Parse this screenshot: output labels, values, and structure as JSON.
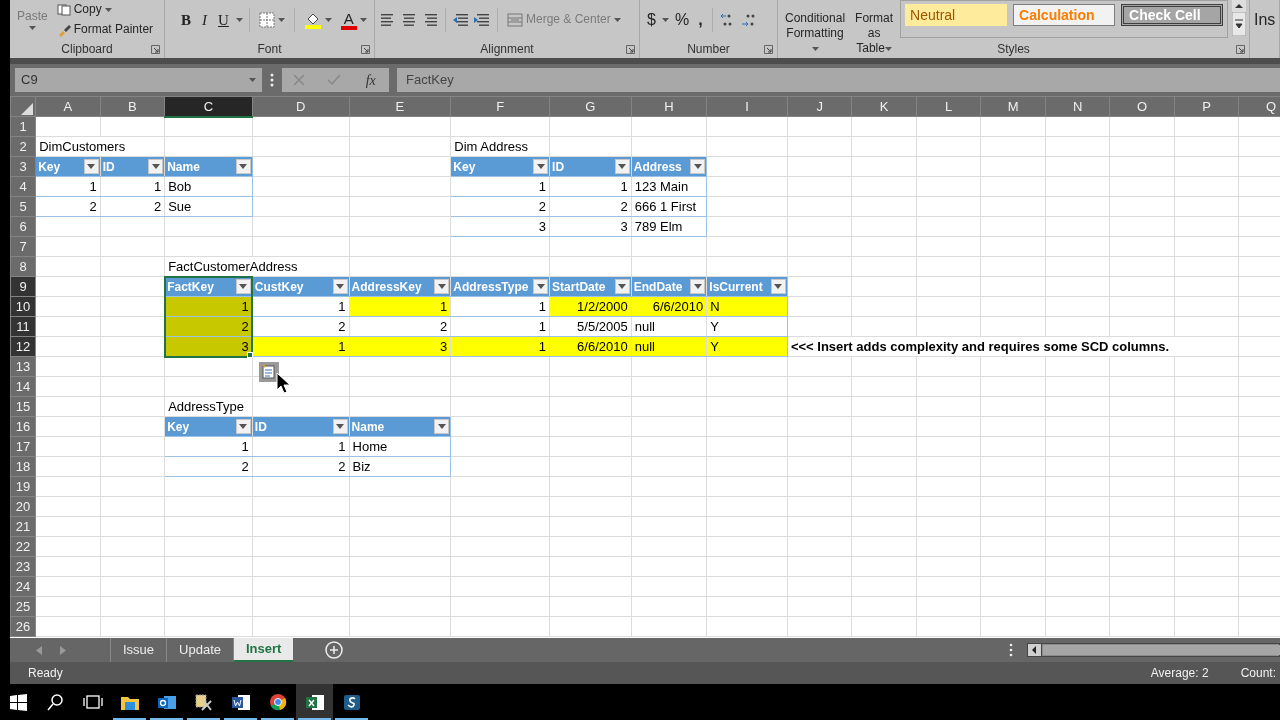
{
  "ribbon": {
    "clipboard": {
      "label": "Clipboard",
      "paste": {
        "label": "Paste",
        "disabled": true
      },
      "copy": "Copy",
      "format_painter": "Format Painter"
    },
    "font": {
      "label": "Font",
      "bold": "B",
      "italic": "I",
      "underline": "U",
      "font_color": "A"
    },
    "alignment": {
      "label": "Alignment",
      "merge": {
        "label": "Merge & Center",
        "disabled": true
      }
    },
    "number": {
      "label": "Number",
      "currency": "$",
      "percent": "%",
      "comma": ","
    },
    "styles": {
      "label": "Styles",
      "conditional_formatting": "Conditional Formatting",
      "format_as_table": "Format as Table",
      "cell_styles": [
        {
          "label": "Neutral",
          "kind": "neutral"
        },
        {
          "label": "Calculation",
          "kind": "calculation"
        },
        {
          "label": "Check Cell",
          "kind": "check"
        }
      ]
    },
    "insert": "Ins"
  },
  "formula_bar": {
    "name_box": "C9",
    "function_label": "fx",
    "value": "FactKey"
  },
  "sheet": {
    "columns": [
      "A",
      "B",
      "C",
      "D",
      "E",
      "F",
      "G",
      "H",
      "I",
      "J",
      "K",
      "L",
      "M",
      "N",
      "O",
      "P",
      "Q"
    ],
    "rows": [
      "1",
      "2",
      "3",
      "4",
      "5",
      "6",
      "7",
      "8",
      "9",
      "10",
      "11",
      "12",
      "13",
      "14",
      "15",
      "16",
      "17",
      "18",
      "19",
      "20",
      "21",
      "22",
      "23",
      "24",
      "25",
      "26"
    ],
    "labels": [
      {
        "text": "DimCustomers",
        "bold": false
      },
      {
        "text": "Dim Address",
        "bold": false
      },
      {
        "text": "FactCustomerAddress",
        "bold": false
      },
      {
        "text": "<<<  Insert adds complexity and requires some SCD columns.",
        "bold": true
      },
      {
        "text": "AddressType",
        "bold": false
      }
    ],
    "tables": [
      {
        "columns": [
          {
            "label": "Key",
            "selected": false
          },
          {
            "label": "ID",
            "selected": false
          },
          {
            "label": "Name",
            "selected": false
          }
        ],
        "rows": [
          [
            {
              "text": "1",
              "kind": "number"
            },
            {
              "text": "1",
              "kind": "number"
            },
            {
              "text": "Bob",
              "kind": "text"
            }
          ],
          [
            {
              "text": "2",
              "kind": "number"
            },
            {
              "text": "2",
              "kind": "number"
            },
            {
              "text": "Sue",
              "kind": "text"
            }
          ]
        ]
      },
      {
        "columns": [
          {
            "label": "Key",
            "selected": false
          },
          {
            "label": "ID",
            "selected": false
          },
          {
            "label": "Address",
            "selected": false
          }
        ],
        "rows": [
          [
            {
              "text": "1",
              "kind": "number"
            },
            {
              "text": "1",
              "kind": "number"
            },
            {
              "text": "123 Main",
              "kind": "text"
            }
          ],
          [
            {
              "text": "2",
              "kind": "number"
            },
            {
              "text": "2",
              "kind": "number"
            },
            {
              "text": "666 1 First",
              "kind": "text"
            }
          ],
          [
            {
              "text": "3",
              "kind": "number"
            },
            {
              "text": "3",
              "kind": "number"
            },
            {
              "text": "789 Elm",
              "kind": "text"
            }
          ]
        ]
      },
      {
        "columns": [
          {
            "label": "FactKey",
            "selected": true
          },
          {
            "label": "CustKey",
            "selected": false
          },
          {
            "label": "AddressKey",
            "selected": false
          },
          {
            "label": "AddressType",
            "selected": false
          },
          {
            "label": "StartDate",
            "selected": false
          },
          {
            "label": "EndDate",
            "selected": false
          },
          {
            "label": "IsCurrent",
            "selected": false
          }
        ],
        "rows": [
          [
            {
              "text": "1",
              "kind": "number",
              "color": "#c8c800"
            },
            {
              "text": "1",
              "kind": "number"
            },
            {
              "text": "1",
              "kind": "number",
              "color": "#ffff00"
            },
            {
              "text": "1",
              "kind": "number"
            },
            {
              "text": "1/2/2000",
              "kind": "number",
              "color": "#ffff00"
            },
            {
              "text": "6/6/2010",
              "kind": "number",
              "color": "#ffff00"
            },
            {
              "text": "N",
              "kind": "text",
              "color": "#ffff00"
            }
          ],
          [
            {
              "text": "2",
              "kind": "number",
              "color": "#c8c800"
            },
            {
              "text": "2",
              "kind": "number"
            },
            {
              "text": "2",
              "kind": "number"
            },
            {
              "text": "1",
              "kind": "number"
            },
            {
              "text": "5/5/2005",
              "kind": "number"
            },
            {
              "text": "null",
              "kind": "text"
            },
            {
              "text": "Y",
              "kind": "text"
            }
          ],
          [
            {
              "text": "3",
              "kind": "number",
              "color": "#c8c800"
            },
            {
              "text": "1",
              "kind": "number",
              "color": "#ffff00"
            },
            {
              "text": "3",
              "kind": "number",
              "color": "#ffff00"
            },
            {
              "text": "1",
              "kind": "number",
              "color": "#ffff00"
            },
            {
              "text": "6/6/2010",
              "kind": "number",
              "color": "#ffff00"
            },
            {
              "text": "null",
              "kind": "text",
              "color": "#ffff00"
            },
            {
              "text": "Y",
              "kind": "text",
              "color": "#ffff00"
            }
          ]
        ]
      },
      {
        "columns": [
          {
            "label": "Key",
            "selected": false
          },
          {
            "label": "ID",
            "selected": false
          },
          {
            "label": "Name",
            "selected": false
          }
        ],
        "rows": [
          [
            {
              "text": "1",
              "kind": "number"
            },
            {
              "text": "1",
              "kind": "number"
            },
            {
              "text": "Home",
              "kind": "text"
            }
          ],
          [
            {
              "text": "2",
              "kind": "number"
            },
            {
              "text": "2",
              "kind": "number"
            },
            {
              "text": "Biz",
              "kind": "text"
            }
          ]
        ]
      }
    ]
  },
  "sheet_tabs": [
    {
      "label": "Issue",
      "selected": false
    },
    {
      "label": "Update",
      "selected": false
    },
    {
      "label": "Insert",
      "selected": true
    }
  ],
  "status_bar": {
    "mode": "Ready",
    "average": "Average: 2",
    "count": "Count:"
  },
  "taskbar": {
    "apps": [
      {
        "kind": "folder",
        "running": true,
        "active": false
      },
      {
        "kind": "mail",
        "running": true,
        "active": false
      },
      {
        "kind": "tool",
        "running": true,
        "active": false
      },
      {
        "kind": "document",
        "running": true,
        "active": false
      },
      {
        "kind": "browser",
        "running": true,
        "active": false
      },
      {
        "kind": "spreadsheet",
        "running": true,
        "active": true
      },
      {
        "kind": "capture",
        "running": true,
        "active": false
      }
    ]
  }
}
